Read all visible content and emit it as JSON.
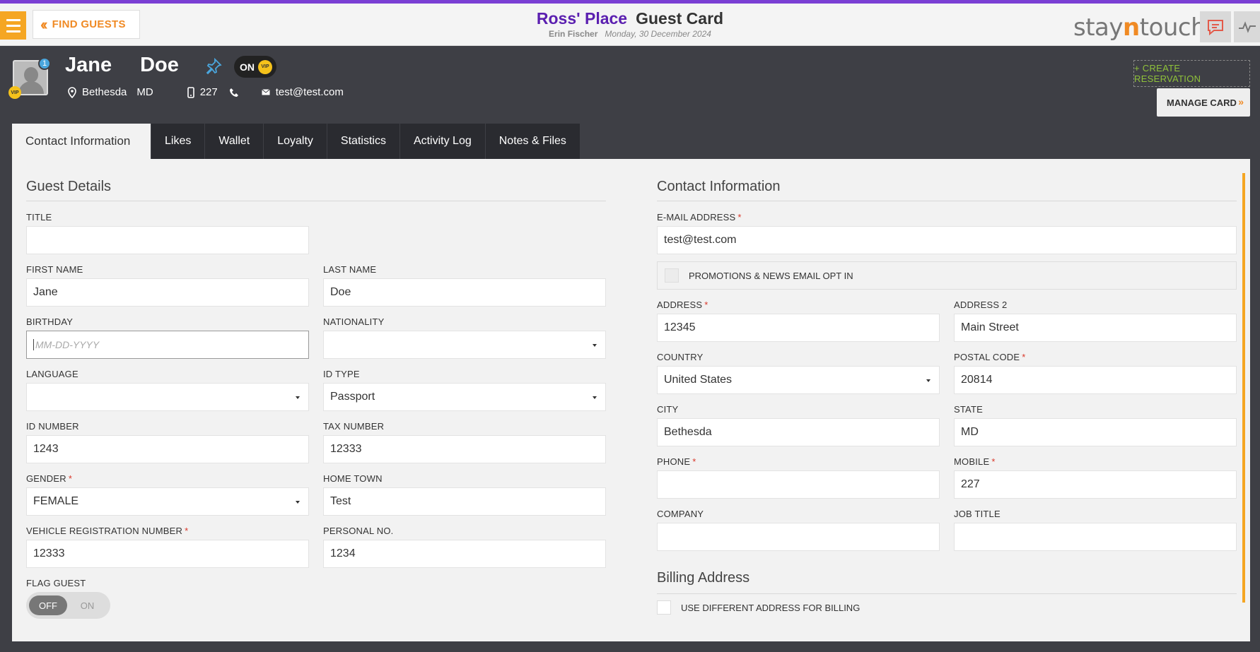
{
  "header": {
    "menu_icon": "hamburger-icon",
    "find_guests_label": "FIND GUESTS",
    "hotel_name": "Ross' Place",
    "page_title": "Guest Card",
    "user_name": "Erin Fischer",
    "date": "Monday, 30 December 2024",
    "logo_prefix": "stay",
    "logo_n": "n",
    "logo_suffix": "touch",
    "chat_icon": "chat-icon",
    "activity_icon": "pulse-icon"
  },
  "guest": {
    "first_name": "Jane",
    "last_name": "Doe",
    "reservation_count": "1",
    "vip_label": "VIP",
    "vip_toggle_state": "ON",
    "city": "Bethesda",
    "state": "MD",
    "mobile": "227",
    "email": "test@test.com",
    "create_reservation_label": "+ CREATE RESERVATION",
    "manage_card_label": "MANAGE CARD"
  },
  "tabs": [
    {
      "label": "Contact Information",
      "active": true
    },
    {
      "label": "Likes"
    },
    {
      "label": "Wallet"
    },
    {
      "label": "Loyalty"
    },
    {
      "label": "Statistics"
    },
    {
      "label": "Activity Log"
    },
    {
      "label": "Notes & Files"
    }
  ],
  "guest_details": {
    "section_title": "Guest Details",
    "title_label": "TITLE",
    "title_value": "",
    "first_name_label": "FIRST NAME",
    "first_name_value": "Jane",
    "last_name_label": "LAST NAME",
    "last_name_value": "Doe",
    "birthday_label": "BIRTHDAY",
    "birthday_placeholder": "MM-DD-YYYY",
    "nationality_label": "NATIONALITY",
    "nationality_value": "",
    "language_label": "LANGUAGE",
    "language_value": "",
    "id_type_label": "ID TYPE",
    "id_type_value": "Passport",
    "id_number_label": "ID NUMBER",
    "id_number_value": "1243",
    "tax_number_label": "TAX NUMBER",
    "tax_number_value": "12333",
    "gender_label": "GENDER",
    "gender_value": "FEMALE",
    "home_town_label": "HOME TOWN",
    "home_town_value": "Test",
    "vehicle_label": "VEHICLE REGISTRATION NUMBER",
    "vehicle_value": "12333",
    "personal_no_label": "PERSONAL NO.",
    "personal_no_value": "1234",
    "flag_guest_label": "FLAG GUEST",
    "flag_off": "OFF",
    "flag_on": "ON"
  },
  "contact_info": {
    "section_title": "Contact Information",
    "email_label": "E-MAIL ADDRESS",
    "email_value": "test@test.com",
    "promotions_label": "PROMOTIONS & NEWS EMAIL OPT IN",
    "address_label": "ADDRESS",
    "address_value": "12345",
    "address2_label": "ADDRESS 2",
    "address2_value": "Main Street",
    "country_label": "COUNTRY",
    "country_value": "United States",
    "postal_label": "POSTAL CODE",
    "postal_value": "20814",
    "city_label": "CITY",
    "city_value": "Bethesda",
    "state_label": "STATE",
    "state_value": "MD",
    "phone_label": "PHONE",
    "phone_value": "",
    "mobile_label": "MOBILE",
    "mobile_value": "227",
    "company_label": "COMPANY",
    "company_value": "",
    "job_title_label": "JOB TITLE",
    "job_title_value": "",
    "billing_title": "Billing Address",
    "billing_checkbox_label": "USE DIFFERENT ADDRESS FOR BILLING"
  },
  "colors": {
    "brand_purple": "#5b1fb0",
    "accent_orange": "#f08a24",
    "vip_gold": "#f5c21b",
    "create_green": "#8fc23a",
    "required_red": "#d9382a"
  }
}
